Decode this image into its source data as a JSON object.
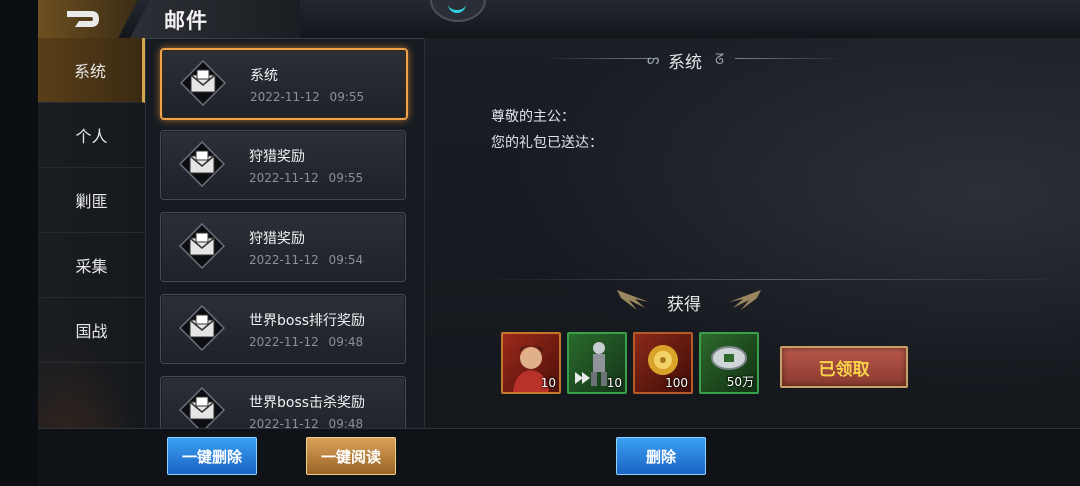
{
  "header": {
    "title": "邮件"
  },
  "tabs": [
    {
      "label": "系统",
      "active": true
    },
    {
      "label": "个人",
      "active": false
    },
    {
      "label": "剿匪",
      "active": false
    },
    {
      "label": "采集",
      "active": false
    },
    {
      "label": "国战",
      "active": false
    }
  ],
  "mails": [
    {
      "title": "系统",
      "time": "2022-11-12 09:55",
      "selected": true
    },
    {
      "title": "狩猎奖励",
      "time": "2022-11-12 09:55",
      "selected": false
    },
    {
      "title": "狩猎奖励",
      "time": "2022-11-12 09:54",
      "selected": false
    },
    {
      "title": "世界boss排行奖励",
      "time": "2022-11-12 09:48",
      "selected": false
    },
    {
      "title": "世界boss击杀奖励",
      "time": "2022-11-12 09:48",
      "selected": false
    }
  ],
  "detail": {
    "title": "系统",
    "line1": "尊敬的主公：",
    "line2": "您的礼包已送达：",
    "gain_title": "获得",
    "claimed_label": "已领取",
    "rewards": [
      {
        "icon": "general-portrait-icon",
        "qty": "10"
      },
      {
        "icon": "soldier-speedup-icon",
        "qty": "10"
      },
      {
        "icon": "gold-orb-icon",
        "qty": "100"
      },
      {
        "icon": "coin-icon",
        "qty": "50万"
      }
    ]
  },
  "buttons": {
    "delete_all": "一键删除",
    "read_all": "一键阅读",
    "delete": "删除"
  }
}
